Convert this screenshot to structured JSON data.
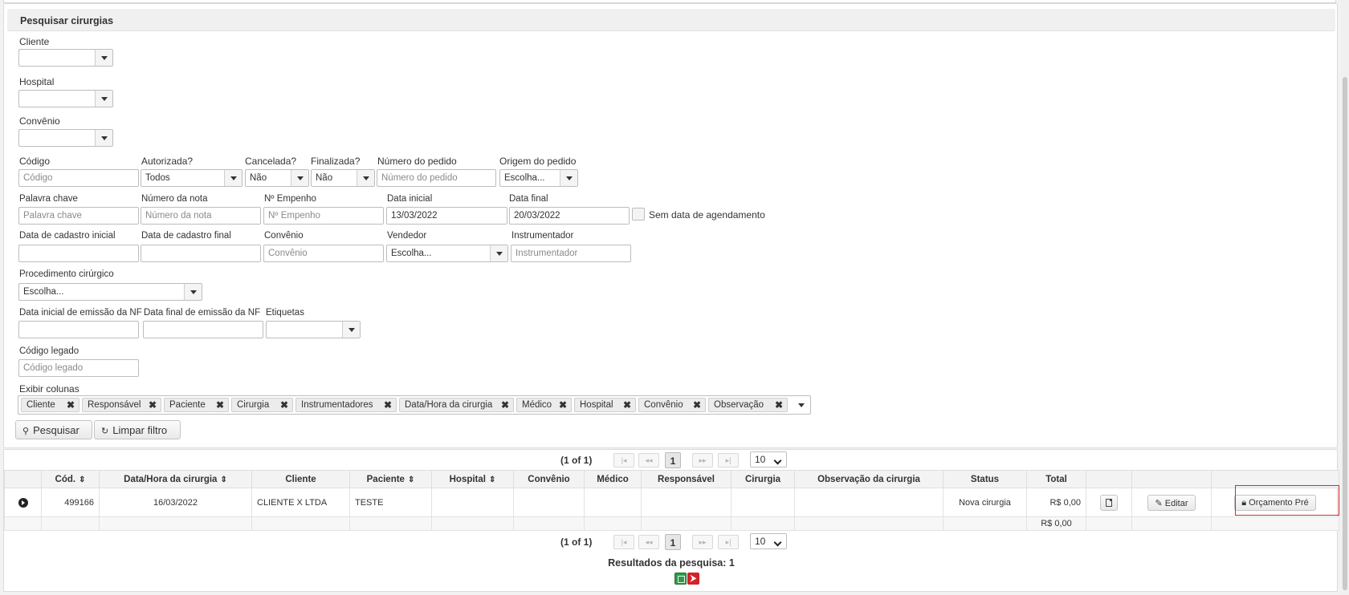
{
  "panel": {
    "title": "Pesquisar cirurgias"
  },
  "filters": {
    "cliente": {
      "label": "Cliente",
      "value": ""
    },
    "hospital": {
      "label": "Hospital",
      "value": ""
    },
    "convenio_top": {
      "label": "Convênio",
      "value": ""
    },
    "codigo": {
      "label": "Código",
      "placeholder": "Código"
    },
    "autorizada": {
      "label": "Autorizada?",
      "value": "Todos"
    },
    "cancelada": {
      "label": "Cancelada?",
      "value": "Não"
    },
    "finalizada": {
      "label": "Finalizada?",
      "value": "Não"
    },
    "numero_pedido": {
      "label": "Número do pedido",
      "placeholder": "Número do pedido"
    },
    "origem_pedido": {
      "label": "Origem do pedido",
      "value": "Escolha..."
    },
    "palavra_chave": {
      "label": "Palavra chave",
      "placeholder": "Palavra chave"
    },
    "numero_nota": {
      "label": "Número da nota",
      "placeholder": "Número da nota"
    },
    "empenho": {
      "label": "Nº Empenho",
      "placeholder": "Nº Empenho"
    },
    "data_inicial": {
      "label": "Data inicial",
      "value": "13/03/2022"
    },
    "data_final": {
      "label": "Data final",
      "value": "20/03/2022"
    },
    "sem_data": {
      "label": "Sem data de agendamento"
    },
    "cadastro_inicial": {
      "label": "Data de cadastro inicial",
      "value": ""
    },
    "cadastro_final": {
      "label": "Data de cadastro final",
      "value": ""
    },
    "convenio": {
      "label": "Convênio",
      "placeholder": "Convênio"
    },
    "vendedor": {
      "label": "Vendedor",
      "value": "Escolha..."
    },
    "instrumentador": {
      "label": "Instrumentador",
      "placeholder": "Instrumentador"
    },
    "procedimento": {
      "label": "Procedimento cirúrgico",
      "value": "Escolha..."
    },
    "nf_inicial": {
      "label": "Data inicial de emissão da NF",
      "value": ""
    },
    "nf_final": {
      "label": "Data final de emissão da NF",
      "value": ""
    },
    "etiquetas": {
      "label": "Etiquetas",
      "value": ""
    },
    "codigo_legado": {
      "label": "Código legado",
      "placeholder": "Código legado"
    },
    "exibir_colunas": {
      "label": "Exibir colunas",
      "chips": [
        "Cliente",
        "Responsável",
        "Paciente",
        "Cirurgia",
        "Instrumentadores",
        "Data/Hora da cirurgia",
        "Médico",
        "Hospital",
        "Convênio",
        "Observação"
      ]
    }
  },
  "buttons": {
    "pesquisar": "Pesquisar",
    "limpar": "Limpar filtro"
  },
  "pager": {
    "page_info": "(1 of 1)",
    "current_page": "1",
    "rows_per_page": "10"
  },
  "table": {
    "headers": [
      "Cód.",
      "Data/Hora da cirurgia",
      "Cliente",
      "Paciente",
      "Hospital",
      "Convênio",
      "Médico",
      "Responsável",
      "Cirurgia",
      "Observação da cirurgia",
      "Status",
      "Total"
    ],
    "row": {
      "codigo": "499166",
      "data_hora": "16/03/2022",
      "cliente": "CLIENTE X LTDA",
      "paciente": "TESTE",
      "hospital": "",
      "convenio": "",
      "medico": "",
      "responsavel": "",
      "cirurgia": "",
      "observacao": "",
      "status": "Nova cirurgia",
      "total": "R$ 0,00",
      "editar": "Editar",
      "orcamento": "Orçamento Pré"
    },
    "footer_total": "R$ 0,00"
  },
  "summary": "Resultados da pesquisa: 1"
}
